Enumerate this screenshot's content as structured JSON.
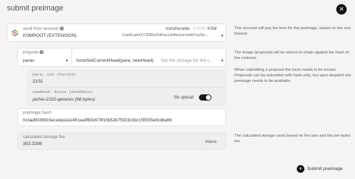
{
  "modal": {
    "title": "submit preimage",
    "close_icon": "close-icon",
    "close_glyph": "✕"
  },
  "account": {
    "label": "send from account",
    "name": "KSMROOT (EXTENSION)",
    "address": "Cop9LwkX1TZDRoZhRuvJuh4leSzeVet6tTxySa…",
    "transferrable_label": "transferrable",
    "transferrable_value": "0.0000",
    "transferrable_unit": "KSM",
    "help": "This account will pay the fees for the preimage, based on the size thereof."
  },
  "propose": {
    "label": "propose",
    "module": "paras",
    "method": "forceSetCurrentHead(para, newHead)",
    "method_hint": "Set the storage for the c…",
    "help": "The image (proposal) will be stored on-chain against the hash of the contents."
  },
  "params": {
    "para_label": "para: u32 (ParaId)",
    "para_value": "2102",
    "newhead_label": "newHead: Bytes (HeadData)",
    "newhead_value": "pichiu-2102-genesis (98 bytes)",
    "file_upload_label": "file upload",
    "file_upload_on": true,
    "help": "When submitting a proposal the hash needs to be known. Proposals can be submitted with hash-only, but upon dispatch the preimage needs to be available."
  },
  "preimage_hash": {
    "label": "preimage hash",
    "value": "0x3ad9336915eceda1a1e491ea9f83c678f15b52b75923c3bc155505e0cdba66"
  },
  "storage_fee": {
    "label": "calculated storage fee",
    "value": "353.3298",
    "unit": "micro",
    "help": "The calculated storage costs based on the size and the per-bytes fee."
  },
  "footer": {
    "submit_label": "Submit preimage",
    "submit_icon": "plus-icon",
    "submit_glyph": "+"
  }
}
